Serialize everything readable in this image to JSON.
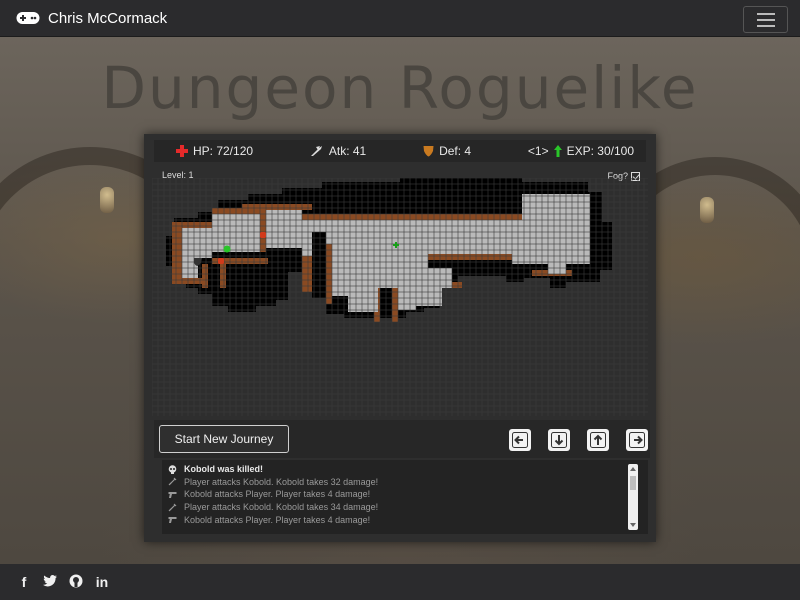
{
  "nav": {
    "brand": "Chris McCormack"
  },
  "title": "Dungeon Roguelike",
  "stats": {
    "hp": "HP: 72/120",
    "atk": "Atk: 41",
    "def": "Def: 4",
    "level_badge": "<1>",
    "exp": "EXP: 30/100"
  },
  "info": {
    "level": "Level: 1",
    "fog_label": "Fog?",
    "fog_checked": true
  },
  "controls": {
    "start_label": "Start New Journey"
  },
  "log": [
    {
      "icon": "skull-icon",
      "text": "Kobold was killed!"
    },
    {
      "icon": "sword-icon",
      "text": "Player attacks Kobold. Kobold takes 32 damage!"
    },
    {
      "icon": "gun-icon",
      "text": "Kobold attacks Player. Player takes 4 damage!"
    },
    {
      "icon": "sword-icon",
      "text": "Player attacks Kobold. Kobold takes 34 damage!"
    },
    {
      "icon": "gun-icon",
      "text": "Kobold attacks Player. Player takes 4 damage!"
    }
  ],
  "footer": {
    "facebook": "f",
    "linkedin": "in"
  },
  "colors": {
    "hp": "#e52a2a",
    "exp": "#29c529",
    "def": "#c97a20",
    "floor": "#b9b9b9",
    "wall": "#8a4a22",
    "dark": "#000000"
  }
}
